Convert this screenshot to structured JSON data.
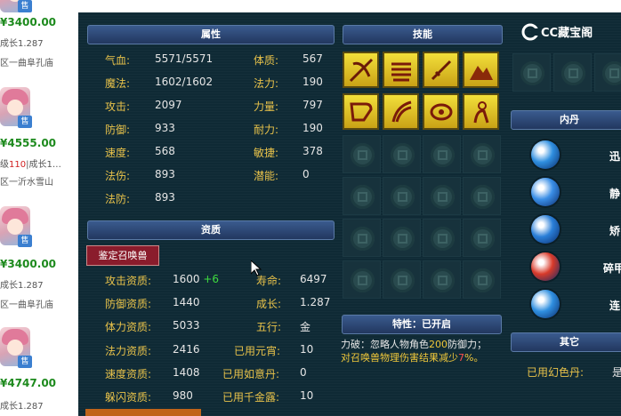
{
  "listing": [
    {
      "price": "3400.00",
      "growth_label": "成长",
      "growth_value": "1.287",
      "server": "区一曲阜孔庙",
      "sold": "售"
    },
    {
      "price": "4555.00",
      "level": "110",
      "growth_label": "成长1…",
      "server": "区一沂水雪山",
      "sold": "售"
    },
    {
      "price": "3400.00",
      "growth_label": "成长",
      "growth_value": "1.287",
      "server": "区一曲阜孔庙",
      "sold": "售"
    },
    {
      "price": "4747.00",
      "growth_label": "成长",
      "growth_value": "1.287",
      "sold": "售"
    }
  ],
  "panel": {
    "attributes_header": "属性",
    "attributes": [
      {
        "label": "气血:",
        "value": "5571/5571"
      },
      {
        "label": "魔法:",
        "value": "1602/1602"
      },
      {
        "label": "攻击:",
        "value": "2097"
      },
      {
        "label": "防御:",
        "value": "933"
      },
      {
        "label": "速度:",
        "value": "568"
      },
      {
        "label": "法伤:",
        "value": "893"
      },
      {
        "label": "法防:",
        "value": "893"
      }
    ],
    "attributes_right": [
      {
        "label": "体质:",
        "value": "567"
      },
      {
        "label": "法力:",
        "value": "190"
      },
      {
        "label": "力量:",
        "value": "797"
      },
      {
        "label": "耐力:",
        "value": "190"
      },
      {
        "label": "敏捷:",
        "value": "378"
      },
      {
        "label": "潜能:",
        "value": "0"
      }
    ],
    "aptitude_header": "资质",
    "identify_button": "鉴定召唤兽",
    "aptitude": [
      {
        "label": "攻击资质:",
        "value": "1600",
        "bonus": "+6"
      },
      {
        "label": "防御资质:",
        "value": "1440"
      },
      {
        "label": "体力资质:",
        "value": "5033"
      },
      {
        "label": "法力资质:",
        "value": "2416"
      },
      {
        "label": "速度资质:",
        "value": "1408"
      },
      {
        "label": "躲闪资质:",
        "value": "980"
      }
    ],
    "aptitude_right": [
      {
        "label": "寿命:",
        "value": "6497"
      },
      {
        "label": "成长:",
        "value": "1.287"
      },
      {
        "label": "五行:",
        "value": "金"
      },
      {
        "label": "已用元宵:",
        "value": "10"
      },
      {
        "label": "已用如意丹:",
        "value": "0"
      },
      {
        "label": "已用千金露:",
        "value": "10"
      }
    ],
    "skills_header": "技能",
    "skills": [
      "sword-bow-icon",
      "scroll-icon",
      "dagger-icon",
      "mountain-icon",
      "bow-icon",
      "claw-icon",
      "fire-eye-icon",
      "figure-icon"
    ],
    "trait_header": "特性：已开启",
    "trait_line1_prefix": "力破：忽略人物角色",
    "trait_line1_num": "200",
    "trait_line1_suffix": "防御力；",
    "trait_line2_prefix": "对召唤兽物理伤害结果减少",
    "trait_line2_num": "7",
    "trait_line2_suffix": "%。",
    "logo_text": "CC藏宝阁",
    "neidan_header": "内丹",
    "neidan": [
      {
        "name": "迅",
        "color": "#2f8fe0"
      },
      {
        "name": "静",
        "color": "#3a8ee6"
      },
      {
        "name": "矫",
        "color": "#2a7fd8"
      },
      {
        "name": "碎甲",
        "color": "#d83a2a"
      },
      {
        "name": "连",
        "color": "#2f8fe0"
      }
    ],
    "other_header": "其它",
    "used_fantasy_label": "已用幻色丹:",
    "used_fantasy_value": "是",
    "colors": {
      "label": "#e8c24a",
      "value": "#e6e6e6",
      "plus": "#3fdc3f",
      "price": "#1d8a1d"
    }
  }
}
